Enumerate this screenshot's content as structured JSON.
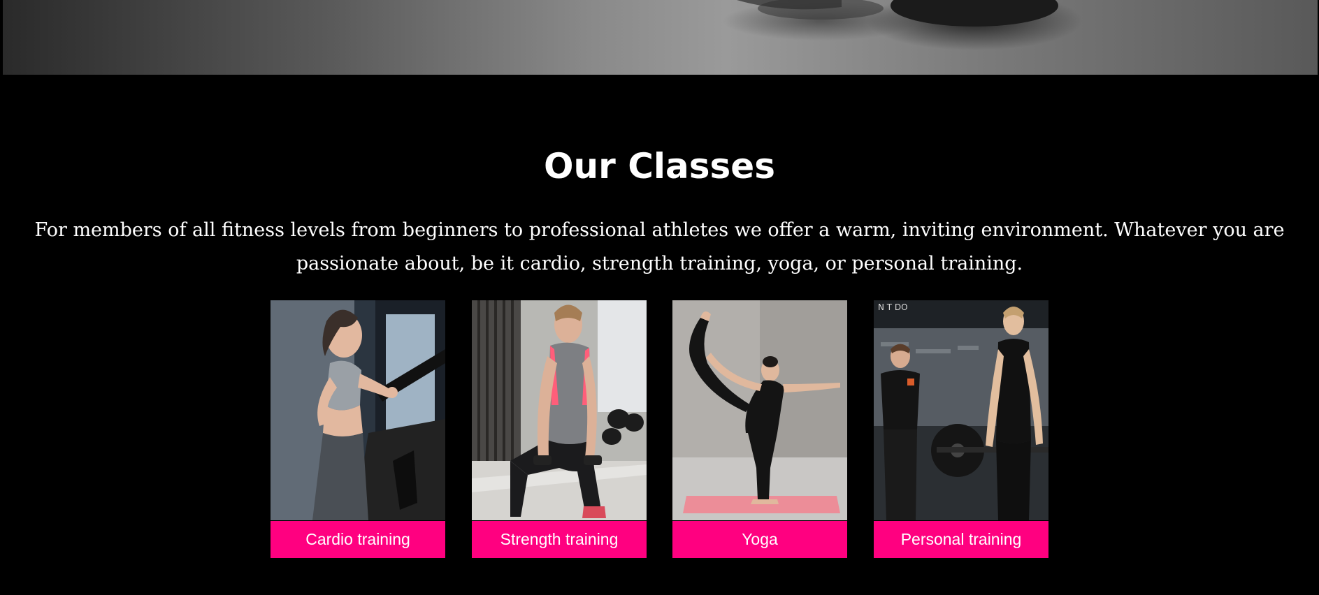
{
  "classes_section": {
    "title": "Our Classes",
    "description": "For members of all fitness levels from beginners to professional athletes we offer a warm, inviting environment. Whatever you are passionate about, be it cardio, strength training, yoga, or personal training."
  },
  "classes": [
    {
      "label": "Cardio training",
      "photo": "woman-running-treadmill-photo"
    },
    {
      "label": "Strength training",
      "photo": "woman-lunge-dumbbells-photo"
    },
    {
      "label": "Yoga",
      "photo": "woman-yoga-pose-photo"
    },
    {
      "label": "Personal training",
      "photo": "trainer-and-client-barbell-photo"
    }
  ],
  "colors": {
    "background": "#000000",
    "accent": "#ff0080",
    "text": "#ffffff"
  }
}
